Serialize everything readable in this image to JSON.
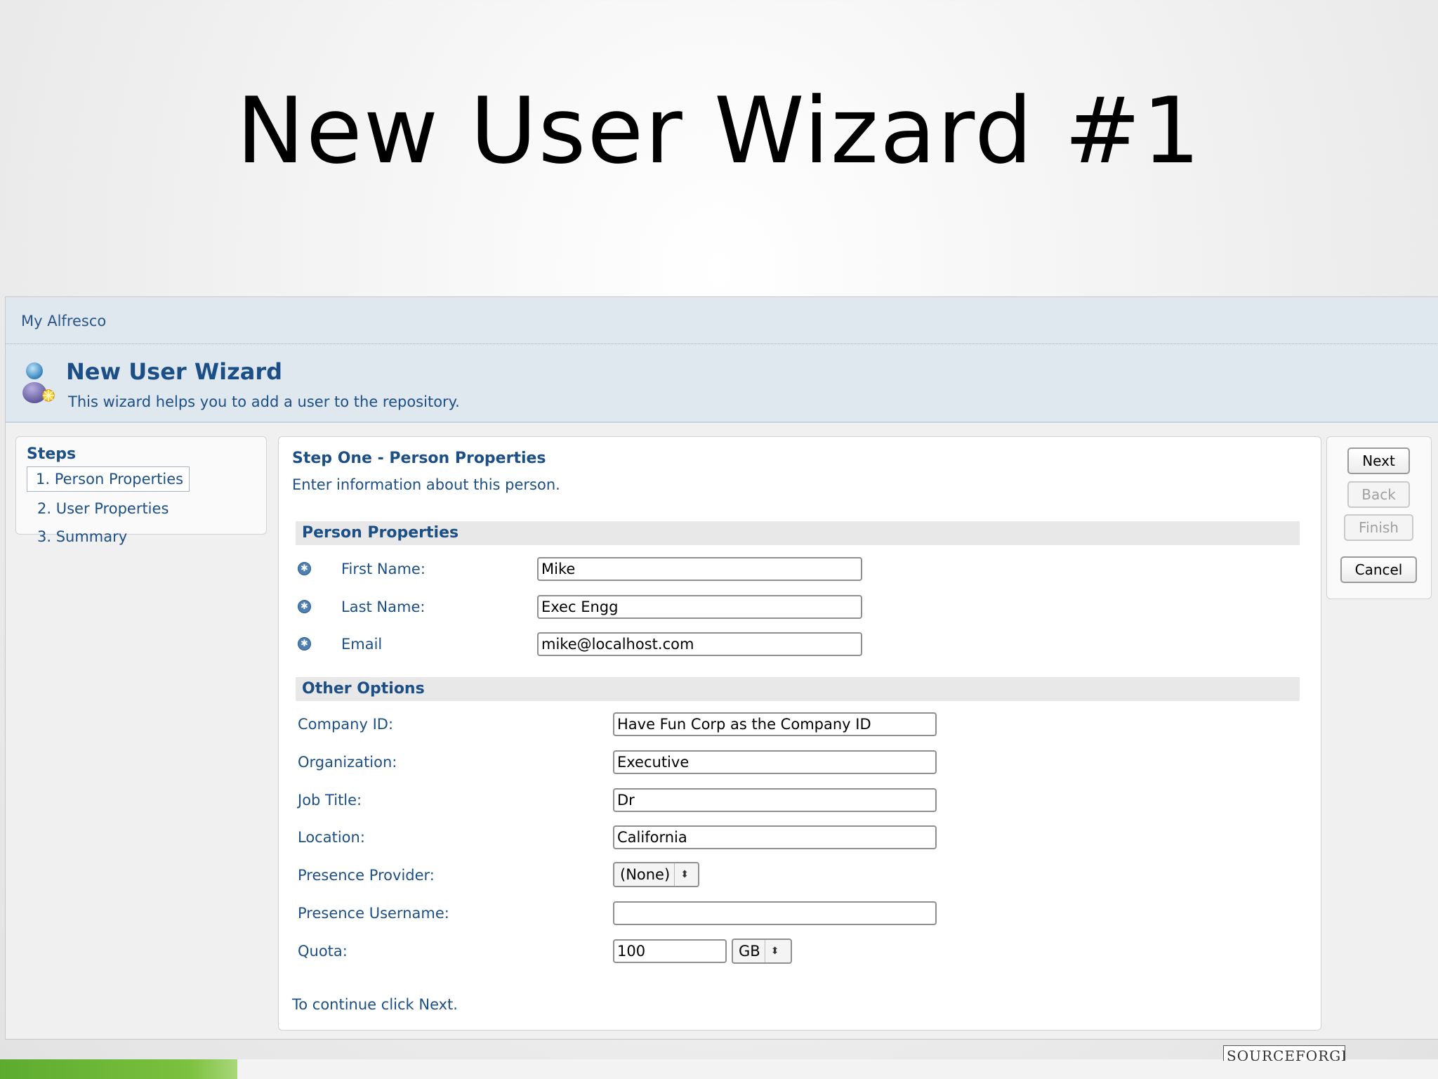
{
  "slide": {
    "title": "New User Wizard #1"
  },
  "app": {
    "breadcrumb": "My Alfresco"
  },
  "wizard": {
    "title": "New User Wizard",
    "description": "This wizard helps you to add a user to the repository."
  },
  "steps": {
    "title": "Steps",
    "items": [
      {
        "label": "1. Person Properties",
        "active": true
      },
      {
        "label": "2. User Properties",
        "active": false
      },
      {
        "label": "3. Summary",
        "active": false
      }
    ]
  },
  "main": {
    "title": "Step One - Person Properties",
    "description": "Enter information about this person.",
    "person_section": "Person Properties",
    "other_section": "Other Options",
    "continue_text": "To continue click Next."
  },
  "person_fields": {
    "first_name": {
      "label": "First Name:",
      "value": "Mike"
    },
    "last_name": {
      "label": "Last Name:",
      "value": "Exec Engg"
    },
    "email": {
      "label": "Email",
      "value": "mike@localhost.com"
    }
  },
  "other_fields": {
    "company_id": {
      "label": "Company ID:",
      "value": "Have Fun Corp as the Company ID"
    },
    "organization": {
      "label": "Organization:",
      "value": "Executive"
    },
    "job_title": {
      "label": "Job Title:",
      "value": "Dr"
    },
    "location": {
      "label": "Location:",
      "value": "California"
    },
    "presence_provider": {
      "label": "Presence Provider:",
      "value": "(None)"
    },
    "presence_username": {
      "label": "Presence Username:",
      "value": ""
    },
    "quota": {
      "label": "Quota:",
      "value": "100",
      "unit": "GB"
    }
  },
  "buttons": {
    "next": "Next",
    "back": "Back",
    "finish": "Finish",
    "cancel": "Cancel"
  },
  "footer": {
    "logo_text": "SOURCEFORGE"
  },
  "icons": {
    "user": "user-add-icon",
    "required": "required-asterisk-icon",
    "select_arrows": "updown-arrows-icon"
  }
}
